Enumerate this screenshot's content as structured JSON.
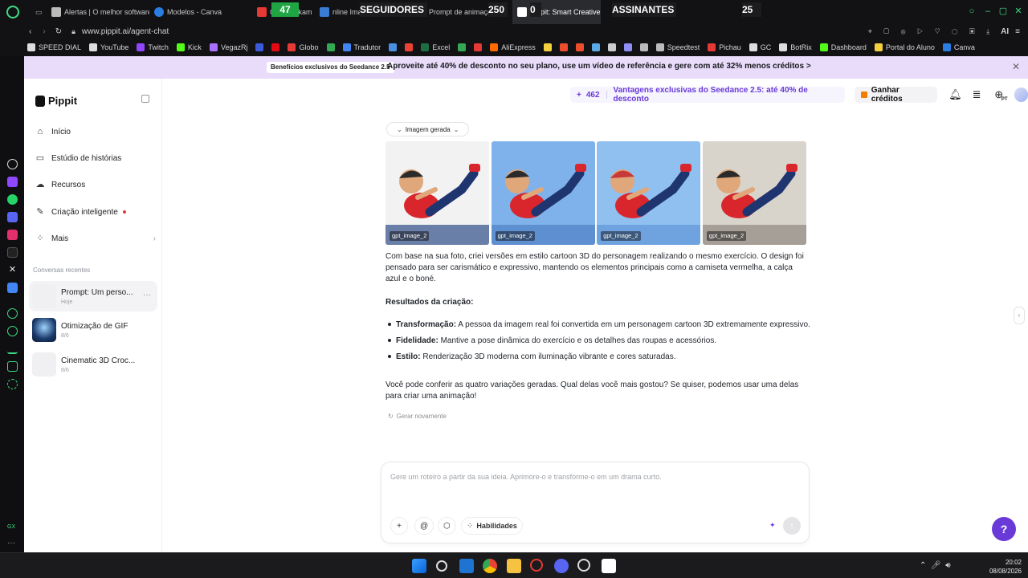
{
  "tabs": [
    {
      "label": "Alertas | O melhor software",
      "color": "#bbbbbb"
    },
    {
      "label": "Modelos - Canva",
      "color": "#2a7de1"
    },
    {
      "label": "Op",
      "color": "#e53935"
    },
    {
      "label": "em kikam",
      "color": "#cccccc"
    },
    {
      "label": "nline Imag",
      "color": "#3a7bd5"
    },
    {
      "label": "Prompt de animação car",
      "color": "#999999"
    },
    {
      "label": "Pippit: Smart Creative Agent",
      "color": "#ffffff"
    }
  ],
  "overlay": {
    "followers_count": "47",
    "followers_label": "SEGUIDORES",
    "mid_count_1": "250",
    "mid_count_2": "0",
    "subscribers_label": "ASSINANTES",
    "subscribers_count": "25"
  },
  "address": {
    "url": "www.pippit.ai/agent-chat",
    "ai_label": "AI"
  },
  "bookmarks": [
    {
      "label": "SPEED DIAL",
      "color": "#dddddd"
    },
    {
      "label": "YouTube",
      "color": "#dddddd"
    },
    {
      "label": "Twitch",
      "color": "#9146ff"
    },
    {
      "label": "Kick",
      "color": "#53fc18"
    },
    {
      "label": "VegazRj",
      "color": "#a970ff"
    },
    {
      "label": "",
      "color": "#3b5bdb"
    },
    {
      "label": "",
      "color": "#e50914"
    },
    {
      "label": "Globo",
      "color": "#e53935"
    },
    {
      "label": "",
      "color": "#34a853"
    },
    {
      "label": "Tradutor",
      "color": "#4285f4"
    },
    {
      "label": "",
      "color": "#4a90e2"
    },
    {
      "label": "",
      "color": "#ea4335"
    },
    {
      "label": "Excel",
      "color": "#1d6f42"
    },
    {
      "label": "",
      "color": "#34a853"
    },
    {
      "label": "",
      "color": "#e53935"
    },
    {
      "label": "AliExpress",
      "color": "#ff6a00"
    },
    {
      "label": "",
      "color": "#f4d03f"
    },
    {
      "label": "",
      "color": "#ee4d2d"
    },
    {
      "label": "",
      "color": "#ee4d2d"
    },
    {
      "label": "",
      "color": "#5aa9e6"
    },
    {
      "label": "",
      "color": "#cccccc"
    },
    {
      "label": "",
      "color": "#8e8ef5"
    },
    {
      "label": "",
      "color": "#bbbbbb"
    },
    {
      "label": "Speedtest",
      "color": "#bbbbbb"
    },
    {
      "label": "Pichau",
      "color": "#e53935"
    },
    {
      "label": "GC",
      "color": "#dddddd"
    },
    {
      "label": "BotRix",
      "color": "#dddddd"
    },
    {
      "label": "Dashboard",
      "color": "#53fc18"
    },
    {
      "label": "Portal do Aluno",
      "color": "#f4d03f"
    },
    {
      "label": "Canva",
      "color": "#2a7de1"
    }
  ],
  "promo": {
    "pill": "Benefícios exclusivos do Seedance 2.5",
    "text": "Aproveite até 40% de desconto no seu plano, use um vídeo de referência e gere com até 32% menos créditos  >"
  },
  "brand": "Pippit",
  "nav": {
    "inicio": "Início",
    "historias": "Estúdio de histórias",
    "recursos": "Recursos",
    "criacao": "Criação inteligente",
    "mais": "Mais"
  },
  "recent": {
    "title": "Conversas recentes",
    "items": [
      {
        "title": "Prompt: Um perso...",
        "sub": "Hoje"
      },
      {
        "title": "Otimização de GIF",
        "sub": "8/6"
      },
      {
        "title": "Cinematic 3D Croc...",
        "sub": "8/6"
      }
    ]
  },
  "topbar": {
    "credits": "462",
    "offer": "Vantagens exclusivas do Seedance 2.5: até 40% de desconto",
    "earn": "Ganhar créditos",
    "lang_badge": "PT"
  },
  "chat": {
    "toggle": "Imagem gerada",
    "images": [
      {
        "tag": "gpt_image_2",
        "bg": "#f2f2f2",
        "floor": "#6a7fa8"
      },
      {
        "tag": "gpt_image_2",
        "bg": "#7fb2ea",
        "floor": "#5e8fd0"
      },
      {
        "tag": "gpt_image_2",
        "bg": "#8fc0ef",
        "floor": "#6fa3e0"
      },
      {
        "tag": "gpt_image_2",
        "bg": "#d9d4cb",
        "floor": "#a59f97"
      }
    ],
    "intro": "Com base na sua foto, criei versões em estilo cartoon 3D do personagem realizando o mesmo exercício. O design foi pensado para ser carismático e expressivo, mantendo os elementos principais como a camiseta vermelha, a calça azul e o boné.",
    "results_title": "Resultados da criação:",
    "bullets": [
      {
        "label": "Transformação:",
        "text": " A pessoa da imagem real foi convertida em um personagem cartoon 3D extremamente expressivo."
      },
      {
        "label": "Fidelidade:",
        "text": " Mantive a pose dinâmica do exercício e os detalhes das roupas e acessórios."
      },
      {
        "label": "Estilo:",
        "text": " Renderização 3D moderna com iluminação vibrante e cores saturadas."
      }
    ],
    "outro": "Você pode conferir as quatro variações geradas. Qual delas você mais gostou? Se quiser, podemos usar uma delas para criar uma animação!",
    "regen": "Gerar novamente"
  },
  "composer": {
    "placeholder": "Gere um roteiro a partir da sua ideia. Aprimore-o e transforme-o em um drama curto.",
    "skills": "Habilidades"
  },
  "taskbar": {
    "time": "20:02",
    "date": "08/08/2026"
  },
  "colors": {
    "accent": "#6a3ad9",
    "promo_bg": "#e9dcfb",
    "shirt": "#d9262c",
    "pants": "#1f3570"
  }
}
